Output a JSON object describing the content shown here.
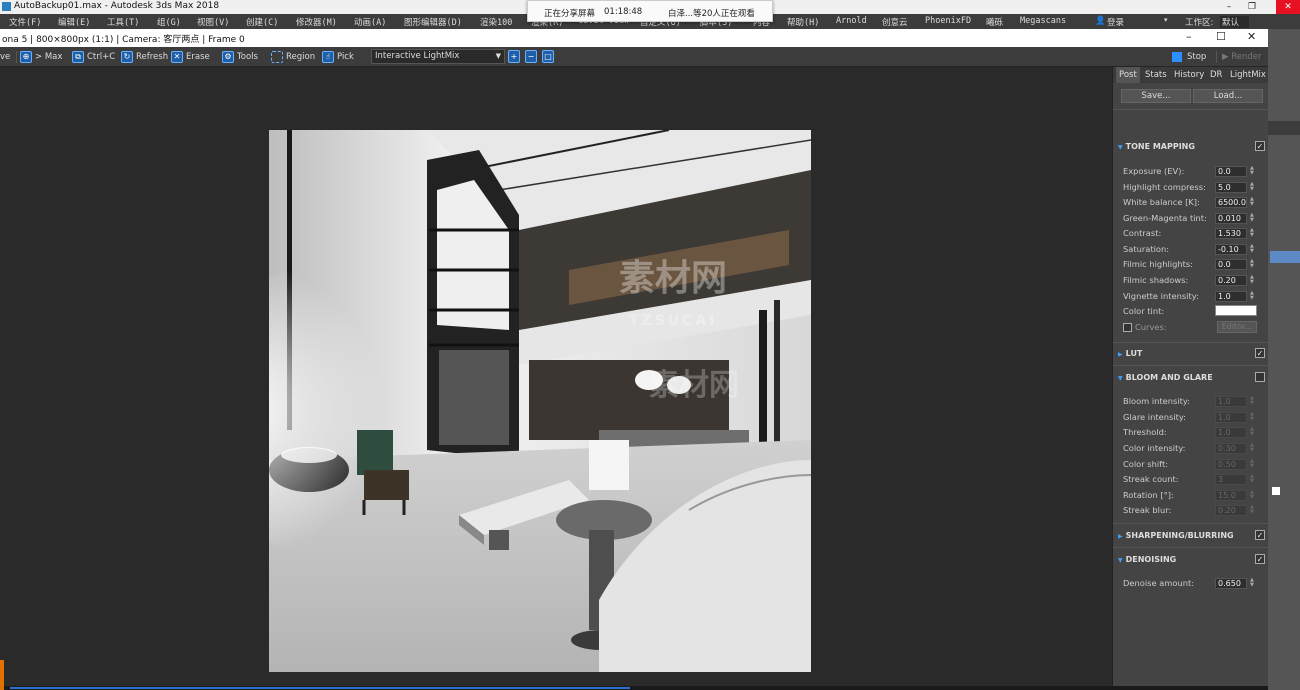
{
  "app": {
    "window_title": "AutoBackup01.max - Autodesk 3ds Max 2018"
  },
  "menubar": {
    "items": [
      "文件(F)",
      "编辑(E)",
      "工具(T)",
      "组(G)",
      "视图(V)",
      "创建(C)",
      "修改器(M)",
      "动画(A)",
      "图形编辑器(D)",
      "渲染(R)",
      "Civil View",
      "自定义(U)",
      "脚本(S)",
      "内容",
      "帮助(H)",
      "Arnold",
      "创意云",
      "PhoenixFD",
      "曦砾",
      "Megascans"
    ],
    "render100": "渲染100",
    "user_label": "登录",
    "workspace_label": "工作区:",
    "workspace_value": "默认"
  },
  "share_banner": {
    "status": "正在分享屏幕",
    "time": "01:18:48",
    "viewers": "白泽...等20人正在观看"
  },
  "vfb": {
    "title": "ona 5 | 800×800px (1:1) | Camera: 客厅两点 | Frame 0",
    "toolbar": {
      "save_partial": "ve",
      "max": "> Max",
      "ctrlc": "Ctrl+C",
      "refresh": "Refresh",
      "erase": "Erase",
      "tools": "Tools",
      "region": "Region",
      "pick": "Pick",
      "lightmix_select": "Interactive LightMix",
      "stop": "Stop",
      "render": "Render"
    },
    "watermark": {
      "main": "素材网",
      "sub": "TZSUCAI"
    }
  },
  "panel": {
    "tabs": [
      "Post",
      "Stats",
      "History",
      "DR",
      "LightMix"
    ],
    "active_tab": "Post",
    "save_button": "Save...",
    "load_button": "Load...",
    "tone_mapping": {
      "header": "TONE MAPPING",
      "enabled": true,
      "rows": [
        {
          "label": "Exposure (EV):",
          "value": "0.0"
        },
        {
          "label": "Highlight compress:",
          "value": "5.0"
        },
        {
          "label": "White balance [K]:",
          "value": "6500.0"
        },
        {
          "label": "Green-Magenta tint:",
          "value": "0.010"
        },
        {
          "label": "Contrast:",
          "value": "1.530"
        },
        {
          "label": "Saturation:",
          "value": "-0.10"
        },
        {
          "label": "Filmic highlights:",
          "value": "0.0"
        },
        {
          "label": "Filmic shadows:",
          "value": "0.20"
        },
        {
          "label": "Vignette intensity:",
          "value": "1.0"
        }
      ],
      "color_tint_label": "Color tint:",
      "color_tint_value": "#ffffff",
      "curves_label": "Curves:",
      "editor_button": "Editor..."
    },
    "lut": {
      "header": "LUT",
      "enabled": true
    },
    "bloom_glare": {
      "header": "BLOOM AND GLARE",
      "enabled": false,
      "rows": [
        {
          "label": "Bloom intensity:",
          "value": "1.0"
        },
        {
          "label": "Glare intensity:",
          "value": "1.0"
        },
        {
          "label": "Threshold:",
          "value": "1.0"
        },
        {
          "label": "Color intensity:",
          "value": "0.30"
        },
        {
          "label": "Color shift:",
          "value": "0.50"
        },
        {
          "label": "Streak count:",
          "value": "3"
        },
        {
          "label": "Rotation [°]:",
          "value": "15.0"
        },
        {
          "label": "Streak blur:",
          "value": "0.20"
        }
      ]
    },
    "sharpening": {
      "header": "SHARPENING/BLURRING",
      "enabled": true
    },
    "denoising": {
      "header": "DENOISING",
      "enabled": true,
      "amount_label": "Denoise amount:",
      "amount_value": "0.650"
    }
  },
  "colors": {
    "accent": "#2c8fff",
    "panel_bg": "#444444",
    "viewport_bg": "#2a2a2a"
  }
}
